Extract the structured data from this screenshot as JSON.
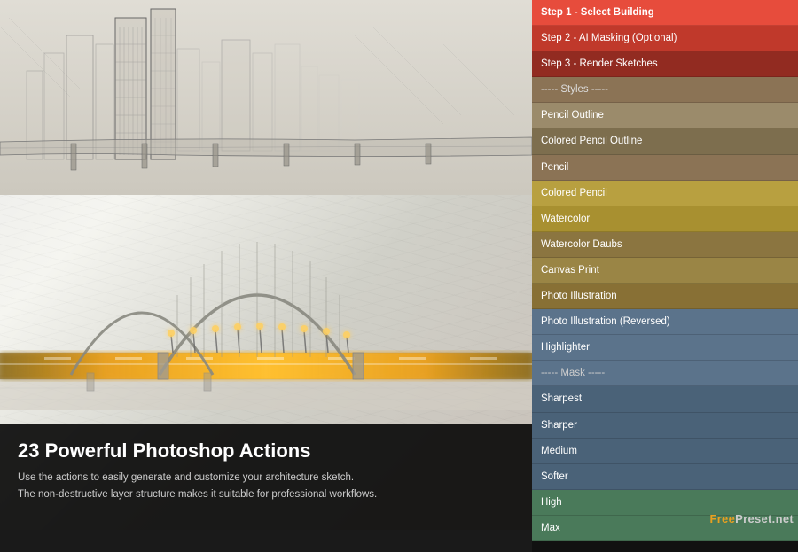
{
  "left": {
    "caption": {
      "title": "23 Powerful Photoshop Actions",
      "line1": "Use the actions to easily generate and customize your architecture sketch.",
      "line2": "The non-destructive layer structure makes it suitable for professional workflows."
    }
  },
  "right": {
    "items": [
      {
        "id": "step1",
        "label": "Step 1 - Select Building",
        "colorClass": "color-red-selected"
      },
      {
        "id": "step2",
        "label": "Step 2 - AI Masking (Optional)",
        "colorClass": "color-red"
      },
      {
        "id": "step3",
        "label": "Step 3 - Render Sketches",
        "colorClass": "color-dark-red"
      },
      {
        "id": "sep1",
        "label": "----- Styles -----",
        "colorClass": "color-separator"
      },
      {
        "id": "pencil-outline",
        "label": "Pencil Outline",
        "colorClass": "color-tan"
      },
      {
        "id": "colored-pencil-outline",
        "label": "Colored Pencil Outline",
        "colorClass": "color-olive2"
      },
      {
        "id": "pencil",
        "label": "Pencil",
        "colorClass": "color-olive"
      },
      {
        "id": "colored-pencil",
        "label": "Colored Pencil",
        "colorClass": "color-yellow-olive"
      },
      {
        "id": "watercolor",
        "label": "Watercolor",
        "colorClass": "color-gold"
      },
      {
        "id": "watercolor-daubs",
        "label": "Watercolor Daubs",
        "colorClass": "color-olive3"
      },
      {
        "id": "canvas-print",
        "label": "Canvas Print",
        "colorClass": "color-olive4"
      },
      {
        "id": "photo-illustration",
        "label": "Photo Illustration",
        "colorClass": "color-olive5"
      },
      {
        "id": "photo-illustration-rev",
        "label": "Photo Illustration (Reversed)",
        "colorClass": "color-blue-gray"
      },
      {
        "id": "highlighter",
        "label": "Highlighter",
        "colorClass": "color-blue-gray"
      },
      {
        "id": "sep2",
        "label": "----- Mask -----",
        "colorClass": "color-sep2"
      },
      {
        "id": "sharpest",
        "label": "Sharpest",
        "colorClass": "color-steel"
      },
      {
        "id": "sharper",
        "label": "Sharper",
        "colorClass": "color-steel2"
      },
      {
        "id": "medium",
        "label": "Medium",
        "colorClass": "color-steel3"
      },
      {
        "id": "softer",
        "label": "Softer",
        "colorClass": "color-steel4"
      },
      {
        "id": "high",
        "label": "High",
        "colorClass": "color-green1"
      },
      {
        "id": "max",
        "label": "Max",
        "colorClass": "color-green2"
      }
    ],
    "badge": {
      "prefix": "Free",
      "suffix": "Preset.net"
    }
  }
}
